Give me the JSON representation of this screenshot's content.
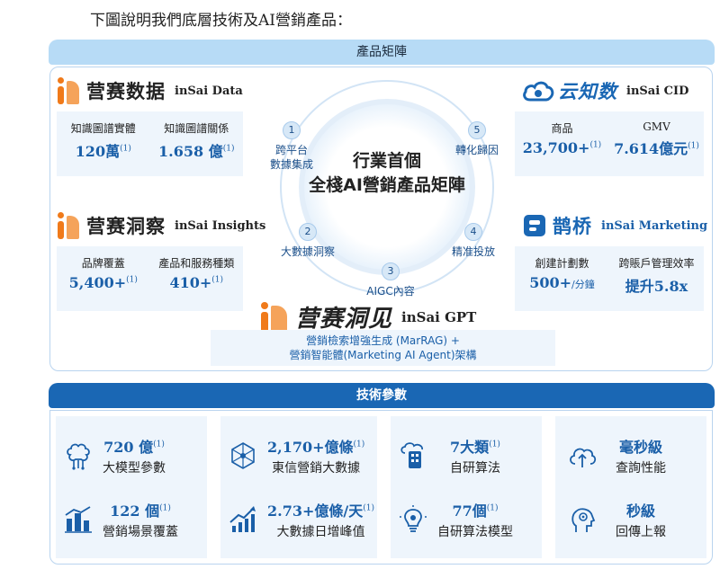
{
  "intro": "下圖說明我們底層技術及AI營銷產品：",
  "product_matrix": {
    "title": "產品矩陣",
    "center_title_line1": "行業首個",
    "center_title_line2": "全棧AI營銷產品矩陣",
    "steps": [
      {
        "num": "1",
        "line1": "跨平台",
        "line2": "數據集成"
      },
      {
        "num": "2",
        "line1": "大數據洞察",
        "line2": ""
      },
      {
        "num": "3",
        "line1": "AIGC內容",
        "line2": ""
      },
      {
        "num": "4",
        "line1": "精准投放",
        "line2": ""
      },
      {
        "num": "5",
        "line1": "轉化歸因",
        "line2": ""
      }
    ],
    "insai_data": {
      "name_cn": "营赛数据",
      "name_en": "inSai Data",
      "stats": [
        {
          "label": "知識圖譜實體",
          "value": "120萬",
          "note": "(1)"
        },
        {
          "label": "知識圖譜關係",
          "value": "1.658 億",
          "note": "(1)"
        }
      ]
    },
    "insai_insights": {
      "name_cn": "营赛洞察",
      "name_en": "inSai Insights",
      "stats": [
        {
          "label": "品牌覆蓋",
          "value": "5,400+",
          "note": "(1)"
        },
        {
          "label": "產品和服務種類",
          "value": "410+",
          "note": "(1)"
        }
      ]
    },
    "insai_cid": {
      "name_cn": "云知数",
      "name_en": "inSai CID",
      "stats": [
        {
          "label": "商品",
          "value": "23,700+",
          "note": "(1)"
        },
        {
          "label": "GMV",
          "value": "7.614億元",
          "note": "(1)"
        }
      ]
    },
    "insai_marketing": {
      "name_cn": "鹊桥",
      "name_en": "inSai Marketing",
      "stats": [
        {
          "label": "創建計劃數",
          "value": "500+",
          "note": "/分鐘"
        },
        {
          "label": "跨賬戶管理效率",
          "value": "提升5.8x",
          "note": ""
        }
      ]
    },
    "insai_gpt": {
      "name_cn": "营赛洞见",
      "name_en": "inSai GPT",
      "desc_line1": "營銷檢索增強生成 (MarRAG) +",
      "desc_line2": "營銷智能體(Marketing AI Agent)架構"
    }
  },
  "tech_params": {
    "title": "技術參數",
    "items": [
      {
        "value": "720 億",
        "note": "(1)",
        "label": "大模型參數",
        "icon": "brain-chip-icon"
      },
      {
        "value": "122 個",
        "note": "(1)",
        "label": "營銷場景覆蓋",
        "icon": "city-chart-icon"
      },
      {
        "value": "2,170+億條",
        "note": "(1)",
        "label": "東信營銷大數據",
        "icon": "network-icon"
      },
      {
        "value": "2.73+億條/天",
        "note": "(1)",
        "label": "大數據日增峰值",
        "icon": "growth-chart-icon"
      },
      {
        "value": "7大類",
        "note": "(1)",
        "label": "自研算法",
        "icon": "cloud-device-icon"
      },
      {
        "value": "77個",
        "note": "(1)",
        "label": "自研算法模型",
        "icon": "lightbulb-icon"
      },
      {
        "value": "毫秒級",
        "note": "",
        "label": "查詢性能",
        "icon": "cloud-upload-icon"
      },
      {
        "value": "秒級",
        "note": "",
        "label": "回傳上報",
        "icon": "head-gear-icon"
      }
    ]
  },
  "colors": {
    "accent": "#1a5fa8",
    "title_bar": "#1a67b4",
    "light_bar": "#b7dbf6",
    "tile": "#eef5fc",
    "logo_orange": "#f07a1a"
  }
}
